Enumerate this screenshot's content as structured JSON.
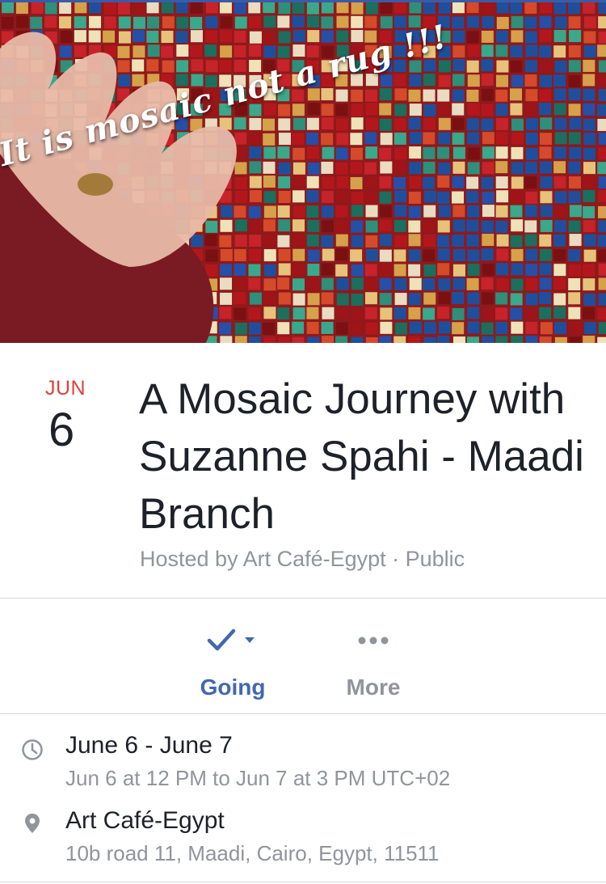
{
  "cover": {
    "caption": "It is mosaic not a rug !!!"
  },
  "event": {
    "month": "JUN",
    "day": "6",
    "title": "A Mosaic Journey with Suzanne Spahi - Maadi Branch",
    "subtitle": "Hosted by Art Café-Egypt · Public"
  },
  "actions": {
    "going_label": "Going",
    "more_label": "More"
  },
  "details": {
    "time_main": "June 6 - June 7",
    "time_sub": "Jun 6 at 12 PM to Jun 7 at 3 PM UTC+02",
    "place_main": "Art Café-Egypt",
    "place_sub": "10b road 11, Maadi, Cairo, Egypt, 11511"
  },
  "icons": {
    "going": "checkmark-icon",
    "dropdown": "caret-down-icon",
    "more": "more-dots-icon",
    "time": "clock-icon",
    "place": "location-pin-icon"
  },
  "colors": {
    "accent": "#4267b2",
    "date_month": "#e0413a",
    "text_primary": "#1d2129",
    "text_secondary": "#90949c",
    "divider": "#d3d6db"
  }
}
